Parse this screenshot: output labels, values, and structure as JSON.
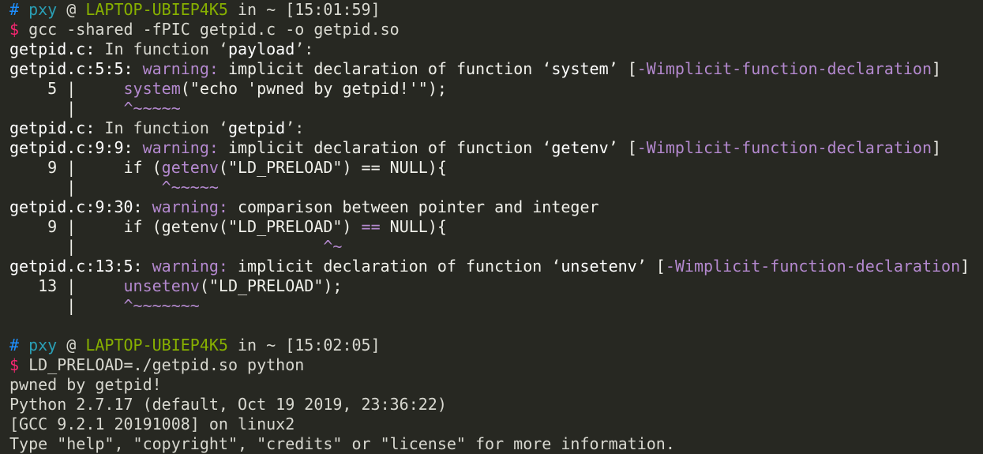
{
  "colors": {
    "background": "#272822",
    "text": "#f0f0ea",
    "hash": "#1e8fff",
    "user": "#2a9fb5",
    "host": "#87b000",
    "dollar": "#f92672",
    "warning": "#b489cf"
  },
  "lines": [
    {
      "segs": [
        {
          "t": "# ",
          "c": "blue"
        },
        {
          "t": "pxy",
          "c": "cyan"
        },
        {
          "t": " @ ",
          "c": "dim"
        },
        {
          "t": "LAPTOP-UBIEP4K5",
          "c": "green"
        },
        {
          "t": " in ~ [15:01:59]",
          "c": "dim"
        }
      ]
    },
    {
      "segs": [
        {
          "t": "$ ",
          "c": "pink"
        },
        {
          "t": "gcc -shared -fPIC getpid.c -o getpid.so",
          "c": "dim"
        }
      ]
    },
    {
      "segs": [
        {
          "t": "getpid.c:",
          "c": "white"
        },
        {
          "t": " In function ‘",
          "c": "dim"
        },
        {
          "t": "payload",
          "c": "white"
        },
        {
          "t": "’:",
          "c": "dim"
        }
      ]
    },
    {
      "segs": [
        {
          "t": "getpid.c:5:5:",
          "c": "white"
        },
        {
          "t": " "
        },
        {
          "t": "warning:",
          "c": "purple"
        },
        {
          "t": " implicit declaration of function ‘"
        },
        {
          "t": "system",
          "c": "white"
        },
        {
          "t": "’ ["
        },
        {
          "t": "-Wimplicit-function-declaration",
          "c": "purple"
        },
        {
          "t": "]"
        }
      ]
    },
    {
      "segs": [
        {
          "t": "    5 |     "
        },
        {
          "t": "system",
          "c": "purple"
        },
        {
          "t": "(\"echo 'pwned by getpid!'\");"
        }
      ]
    },
    {
      "segs": [
        {
          "t": "      |     "
        },
        {
          "t": "^~~~~~",
          "c": "purple"
        }
      ]
    },
    {
      "segs": [
        {
          "t": "getpid.c:",
          "c": "white"
        },
        {
          "t": " In function ‘",
          "c": "dim"
        },
        {
          "t": "getpid",
          "c": "white"
        },
        {
          "t": "’:",
          "c": "dim"
        }
      ]
    },
    {
      "segs": [
        {
          "t": "getpid.c:9:9:",
          "c": "white"
        },
        {
          "t": " "
        },
        {
          "t": "warning:",
          "c": "purple"
        },
        {
          "t": " implicit declaration of function ‘"
        },
        {
          "t": "getenv",
          "c": "white"
        },
        {
          "t": "’ ["
        },
        {
          "t": "-Wimplicit-function-declaration",
          "c": "purple"
        },
        {
          "t": "]"
        }
      ]
    },
    {
      "segs": [
        {
          "t": "    9 |     if ("
        },
        {
          "t": "getenv",
          "c": "purple"
        },
        {
          "t": "(\"LD_PRELOAD\") == NULL){"
        }
      ]
    },
    {
      "segs": [
        {
          "t": "      |         "
        },
        {
          "t": "^~~~~~",
          "c": "purple"
        }
      ]
    },
    {
      "segs": [
        {
          "t": "getpid.c:9:30:",
          "c": "white"
        },
        {
          "t": " "
        },
        {
          "t": "warning:",
          "c": "purple"
        },
        {
          "t": " comparison between pointer and integer"
        }
      ]
    },
    {
      "segs": [
        {
          "t": "    9 |     if (getenv(\"LD_PRELOAD\") "
        },
        {
          "t": "==",
          "c": "purple"
        },
        {
          "t": " NULL){"
        }
      ]
    },
    {
      "segs": [
        {
          "t": "      |                          "
        },
        {
          "t": "^~",
          "c": "purple"
        }
      ]
    },
    {
      "segs": [
        {
          "t": "getpid.c:13:5:",
          "c": "white"
        },
        {
          "t": " "
        },
        {
          "t": "warning:",
          "c": "purple"
        },
        {
          "t": " implicit declaration of function ‘"
        },
        {
          "t": "unsetenv",
          "c": "white"
        },
        {
          "t": "’ ["
        },
        {
          "t": "-Wimplicit-function-declaration",
          "c": "purple"
        },
        {
          "t": "]"
        }
      ]
    },
    {
      "segs": [
        {
          "t": "   13 |     "
        },
        {
          "t": "unsetenv",
          "c": "purple"
        },
        {
          "t": "(\"LD_PRELOAD\");"
        }
      ]
    },
    {
      "segs": [
        {
          "t": "      |     "
        },
        {
          "t": "^~~~~~~~",
          "c": "purple"
        }
      ]
    },
    {
      "segs": []
    },
    {
      "segs": [
        {
          "t": "# ",
          "c": "blue"
        },
        {
          "t": "pxy",
          "c": "cyan"
        },
        {
          "t": " @ ",
          "c": "dim"
        },
        {
          "t": "LAPTOP-UBIEP4K5",
          "c": "green"
        },
        {
          "t": " in ~ [15:02:05]",
          "c": "dim"
        }
      ]
    },
    {
      "segs": [
        {
          "t": "$ ",
          "c": "pink"
        },
        {
          "t": "LD_PRELOAD=./getpid.so python",
          "c": "dim"
        }
      ]
    },
    {
      "segs": [
        {
          "t": "pwned by getpid!",
          "c": "dim"
        }
      ]
    },
    {
      "segs": [
        {
          "t": "Python 2.7.17 (default, Oct 19 2019, 23:36:22)",
          "c": "dim"
        }
      ]
    },
    {
      "segs": [
        {
          "t": "[GCC 9.2.1 20191008] on linux2",
          "c": "dim"
        }
      ]
    },
    {
      "segs": [
        {
          "t": "Type \"help\", \"copyright\", \"credits\" or \"license\" for more information.",
          "c": "dim"
        }
      ]
    }
  ]
}
